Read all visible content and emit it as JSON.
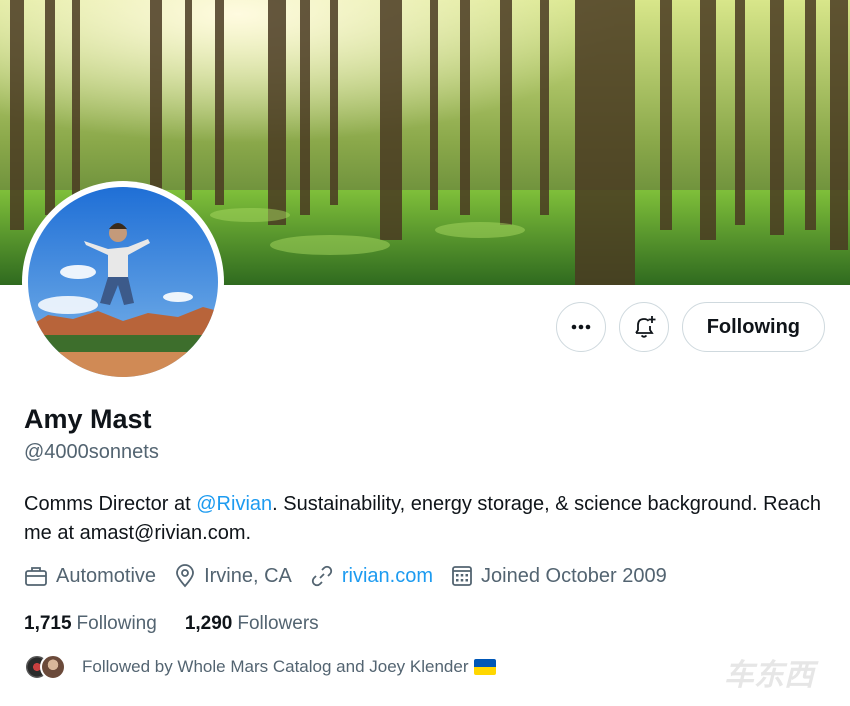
{
  "profile": {
    "name": "Amy Mast",
    "handle": "@4000sonnets",
    "bio_part1": "Comms Director at ",
    "bio_mention": "@Rivian",
    "bio_part2": ". Sustainability, energy storage, & science background. Reach me at amast@rivian.com."
  },
  "meta": {
    "category": "Automotive",
    "location": "Irvine, CA",
    "website": "rivian.com",
    "joined": "Joined October 2009"
  },
  "stats": {
    "following_count": "1,715",
    "following_label": "Following",
    "followers_count": "1,290",
    "followers_label": "Followers"
  },
  "actions": {
    "follow_label": "Following",
    "more_icon": "more-icon",
    "notify_icon": "bell-plus-icon"
  },
  "followed_by": {
    "text": "Followed by Whole Mars Catalog and Joey Klender"
  },
  "watermark": "车东西",
  "colors": {
    "link": "#1d9bf0",
    "secondary_text": "#536471",
    "border": "#cfd9de",
    "flag_blue": "#0057b7",
    "flag_yellow": "#ffd700"
  }
}
